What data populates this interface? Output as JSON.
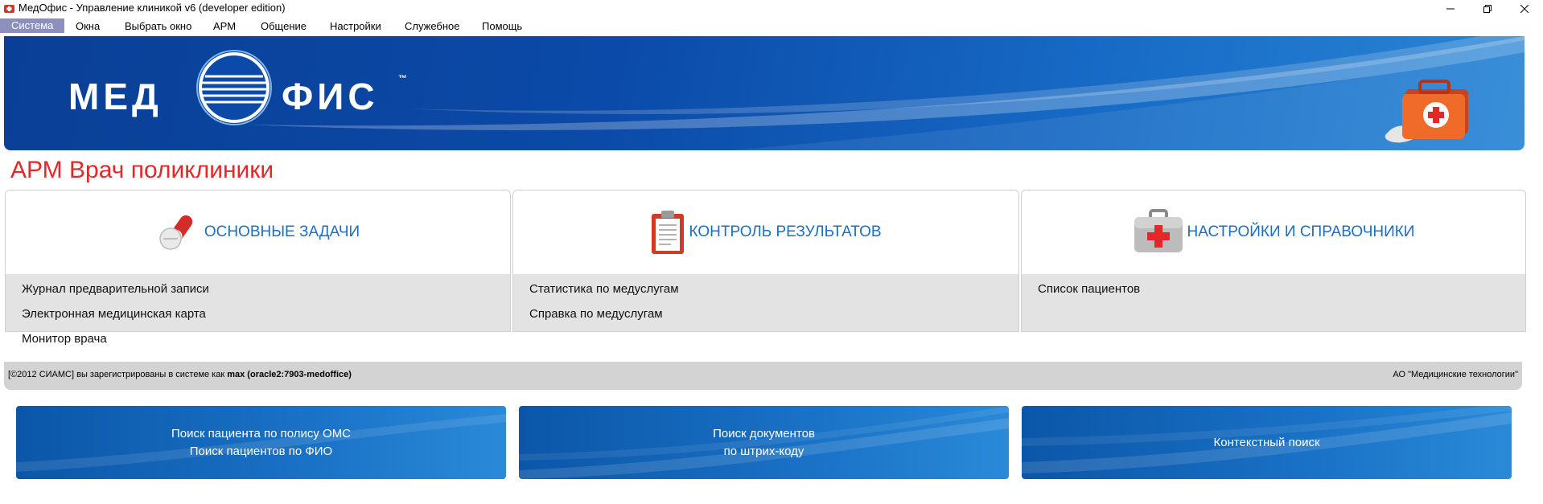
{
  "window": {
    "title": "МедОфис - Управление клиникой v6 (developer edition)"
  },
  "menu": {
    "items": [
      "Система",
      "Окна",
      "Выбрать окно",
      "АРМ",
      "Общение",
      "Настройки",
      "Служебное",
      "Помощь"
    ]
  },
  "banner": {
    "logo_left": "МЕД",
    "logo_right": "ФИС",
    "trademark": "™"
  },
  "workplace_title": "АРМ Врач поликлиники",
  "panels": [
    {
      "title": "ОСНОВНЫЕ ЗАДАЧИ",
      "icon": "pills-icon",
      "links": [
        "Журнал предварительной записи",
        "Электронная медицинская карта",
        "Монитор врача"
      ]
    },
    {
      "title": "КОНТРОЛЬ РЕЗУЛЬТАТОВ",
      "icon": "clipboard-icon",
      "links": [
        "Статистика по медуслугам",
        "Справка по медуслугам"
      ]
    },
    {
      "title": "НАСТРОЙКИ И СПРАВОЧНИКИ",
      "icon": "first-aid-kit-icon",
      "links": [
        "Список пациентов"
      ]
    }
  ],
  "status": {
    "prefix": "[©2012 СИАМС] вы зарегистрированы в системе как",
    "user": "max (oracle2:7903-medoffice)",
    "company": "АО \"Медицинские технологии\""
  },
  "search_buttons": [
    {
      "lines": [
        "Поиск пациента по полису ОМС",
        "Поиск пациентов по ФИО"
      ]
    },
    {
      "lines": [
        "Поиск документов",
        "по штрих-коду"
      ]
    },
    {
      "lines": [
        "Контекстный поиск"
      ]
    }
  ],
  "colors": {
    "banner_blue": "#0b4aa8",
    "accent_red": "#e22828",
    "panel_title_blue": "#1a6fc4",
    "menu_active": "#8d8fbd"
  }
}
